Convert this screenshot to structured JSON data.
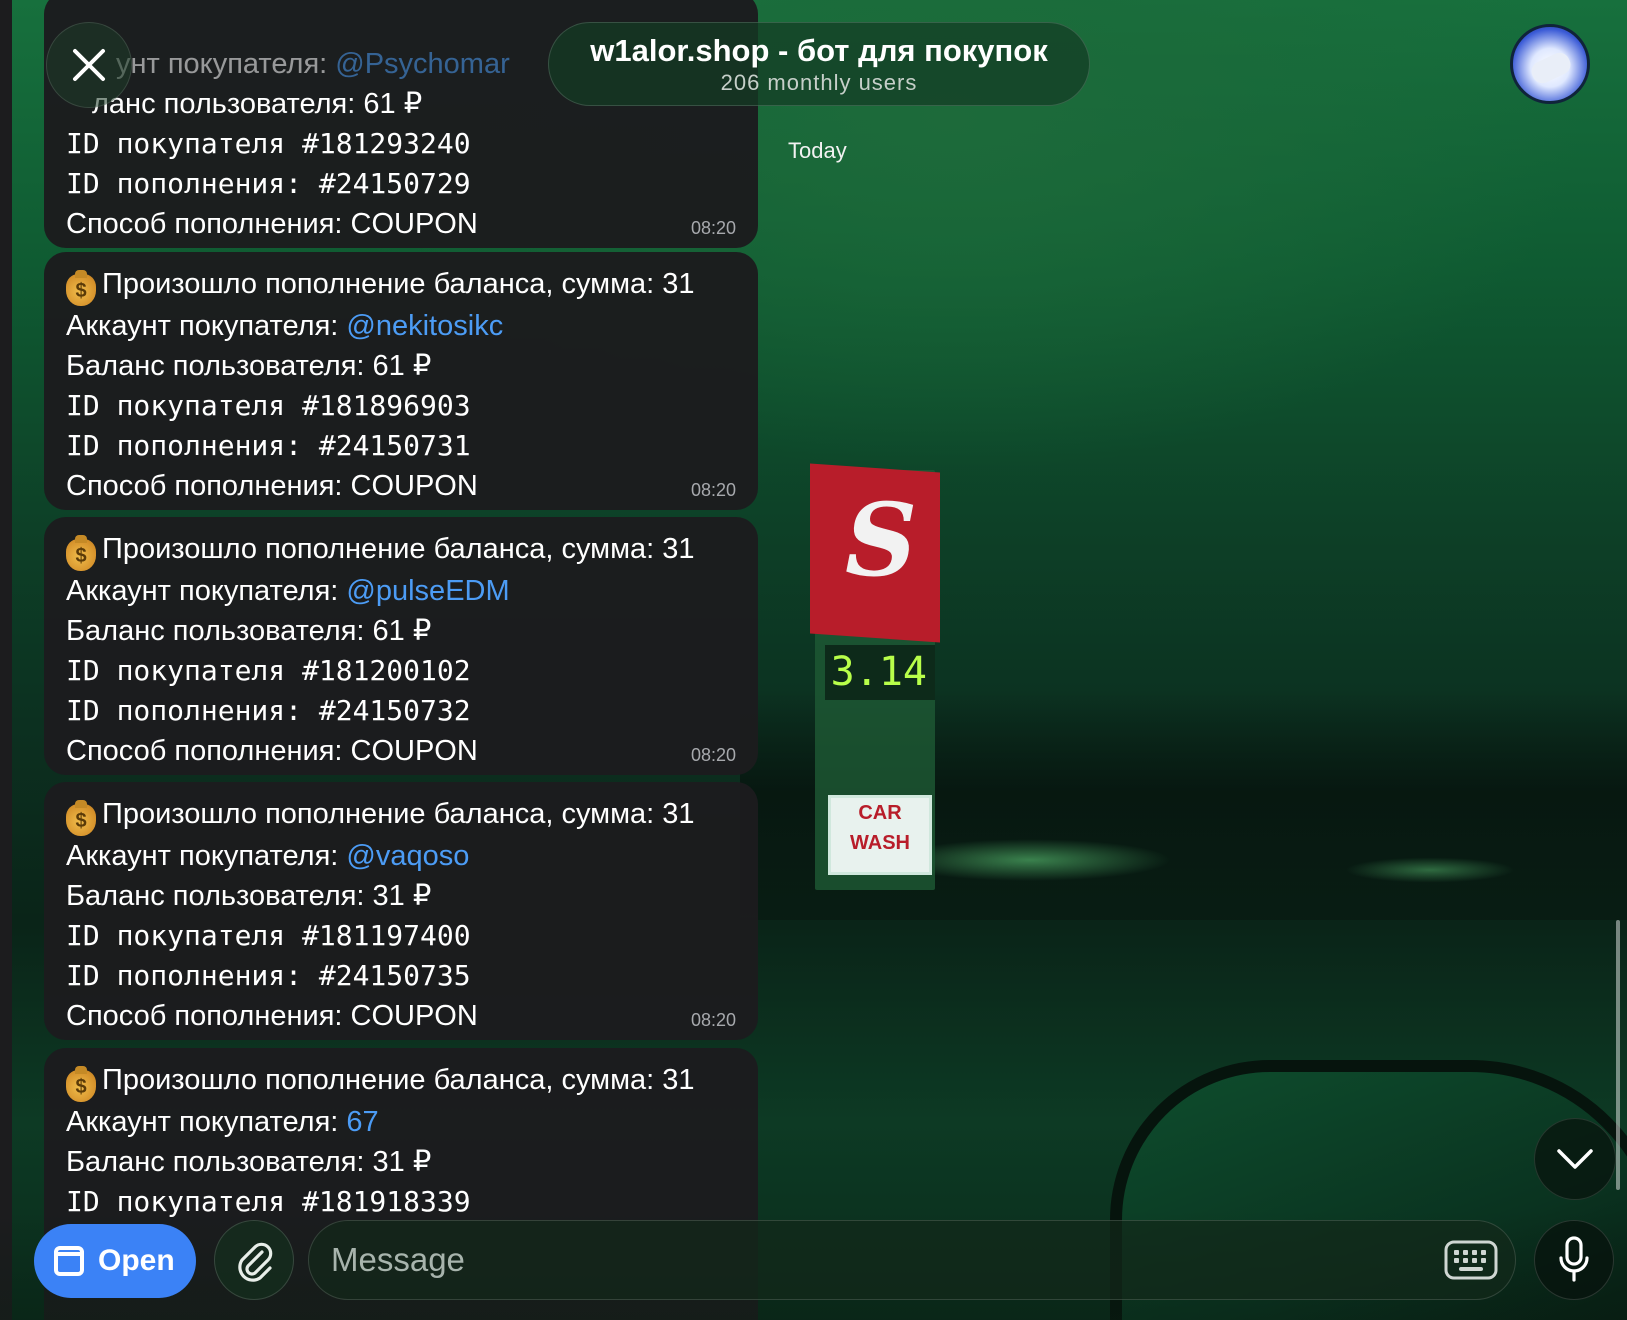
{
  "header": {
    "title": "w1alor.shop - бот для покупок",
    "subtitle": "206 monthly users",
    "date_divider": "Today"
  },
  "messages": [
    {
      "lines_partial": [
        "унт покупателя: ",
        "@Psychomar",
        "ланс пользователя: 61 ₽"
      ],
      "buyer_id": "ID покупателя #181293240",
      "topup_id": "ID пополнения: #24150729",
      "method": "Способ пополнения: COUPON",
      "time": "08:20"
    },
    {
      "headline": "Произошло пополнение баланса, сумма: 31",
      "account_label": "Аккаунт покупателя: ",
      "account": "@nekitosikc",
      "balance": "Баланс пользователя: 61 ₽",
      "buyer_id": "ID покупателя #181896903",
      "topup_id": "ID пополнения: #24150731",
      "method": "Способ пополнения: COUPON",
      "time": "08:20"
    },
    {
      "headline": "Произошло пополнение баланса, сумма: 31",
      "account_label": "Аккаунт покупателя: ",
      "account": "@pulseEDM",
      "balance": "Баланс пользователя: 61 ₽",
      "buyer_id": "ID покупателя #181200102",
      "topup_id": "ID пополнения: #24150732",
      "method": "Способ пополнения: COUPON",
      "time": "08:20"
    },
    {
      "headline": "Произошло пополнение баланса, сумма: 31",
      "account_label": "Аккаунт покупателя: ",
      "account": "@vaqoso",
      "balance": "Баланс пользователя: 31 ₽",
      "buyer_id": "ID покупателя #181197400",
      "topup_id": "ID пополнения: #24150735",
      "method": "Способ пополнения: COUPON",
      "time": "08:20"
    },
    {
      "headline": "Произошло пополнение баланса, сумма: 31",
      "account_label": "Аккаунт покупателя: ",
      "account": "67",
      "balance": "Баланс пользователя: 31 ₽",
      "buyer_id": "ID покупателя #181918339"
    }
  ],
  "bottom_bar": {
    "open_label": "Open",
    "message_placeholder": "Message"
  },
  "icons": {
    "close": "close-icon",
    "avatar": "bot-avatar",
    "money_bag": "money-bag-icon",
    "attach": "paperclip-icon",
    "keyboard": "keyboard-icon",
    "mic": "microphone-icon",
    "scroll_down": "chevron-down-icon"
  },
  "colors": {
    "link": "#4c9cf5",
    "open_button": "#3b82f6",
    "bubble": "#1c1c1e"
  }
}
